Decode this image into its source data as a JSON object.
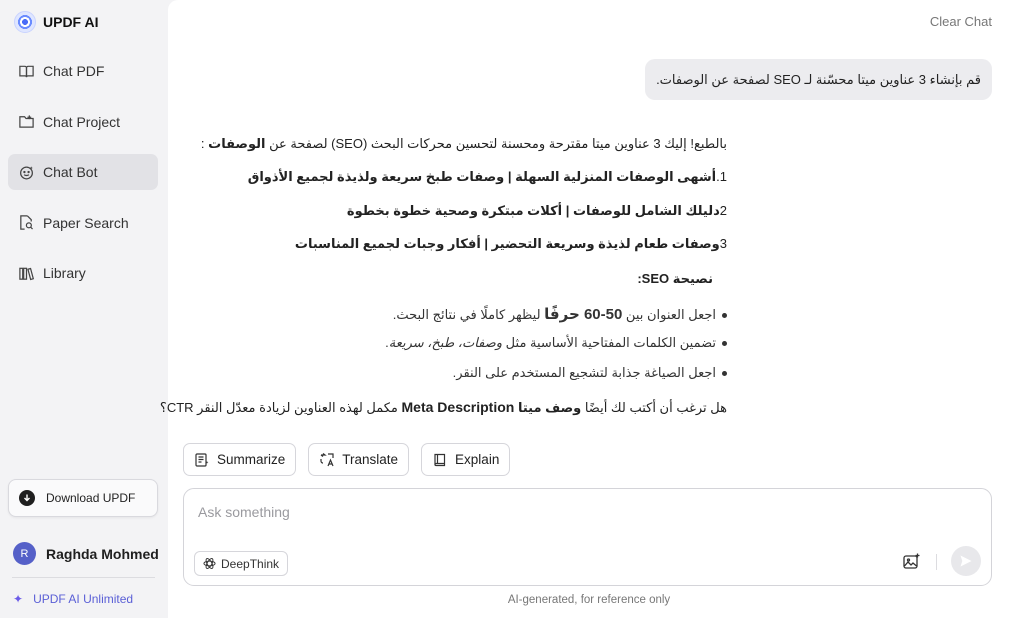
{
  "brand": {
    "name": "UPDF AI"
  },
  "sidebar": {
    "items": [
      {
        "label": "Chat PDF",
        "icon": "book-open-icon"
      },
      {
        "label": "Chat Project",
        "icon": "folder-icon"
      },
      {
        "label": "Chat Bot",
        "icon": "robot-face-icon",
        "active": true
      },
      {
        "label": "Paper Search",
        "icon": "document-search-icon"
      },
      {
        "label": "Library",
        "icon": "books-icon"
      }
    ],
    "download_label": "Download UPDF",
    "user": {
      "initial": "R",
      "name": "Raghda Mohmed"
    },
    "unlimited_label": "UPDF AI Unlimited"
  },
  "header": {
    "clear_chat": "Clear Chat"
  },
  "conversation": {
    "user_message": "قم بإنشاء 3 عناوين ميتا محسّنة لـ SEO لصفحة عن الوصفات.",
    "answer": {
      "intro_plain": "بالطبع! إليك 3 عناوين ميتا مقترحة ومحسنة لتحسين محركات البحث (SEO) لصفحة عن",
      "intro_bold": "الوصفات",
      "intro_tail": " :",
      "titles": [
        {
          "num": "1.",
          "text": "أشهى الوصفات المنزلية السهلة | وصفات طبخ سريعة ولذيذة لجميع الأذواق"
        },
        {
          "num": "2",
          "text": "دليلك الشامل للوصفات | أكلات مبتكرة وصحية خطوة بخطوة"
        },
        {
          "num": "3",
          "text": "وصفات طعام لذيذة وسريعة التحضير | أفكار وجبات لجميع المناسبات"
        }
      ],
      "tip_heading": "نصيحة SEO:",
      "tips": [
        {
          "pre": "اجعل العنوان بين ",
          "bold": "50-60 حرفًا",
          "post": " ليظهر كاملًا في نتائج البحث."
        },
        {
          "pre": "تضمين الكلمات المفتاحية الأساسية مثل ",
          "italic": "وصفات، طبخ، سريعة",
          "post": "."
        },
        {
          "pre": "اجعل الصياغة جذابة لتشجيع المستخدم على النقر.",
          "bold": "",
          "post": ""
        }
      ],
      "closing_pre": "هل ترغب أن أكتب لك أيضًا ",
      "closing_bold1": "وصف ميتا",
      "closing_bold2": "Meta Description",
      "closing_post": " مكمل لهذه العناوين لزيادة معدّل النقر CTR؟"
    }
  },
  "actions": {
    "summarize": "Summarize",
    "translate": "Translate",
    "explain": "Explain"
  },
  "composer": {
    "placeholder": "Ask something",
    "deepthink_label": "DeepThink"
  },
  "footer": {
    "note": "AI-generated, for reference only"
  }
}
